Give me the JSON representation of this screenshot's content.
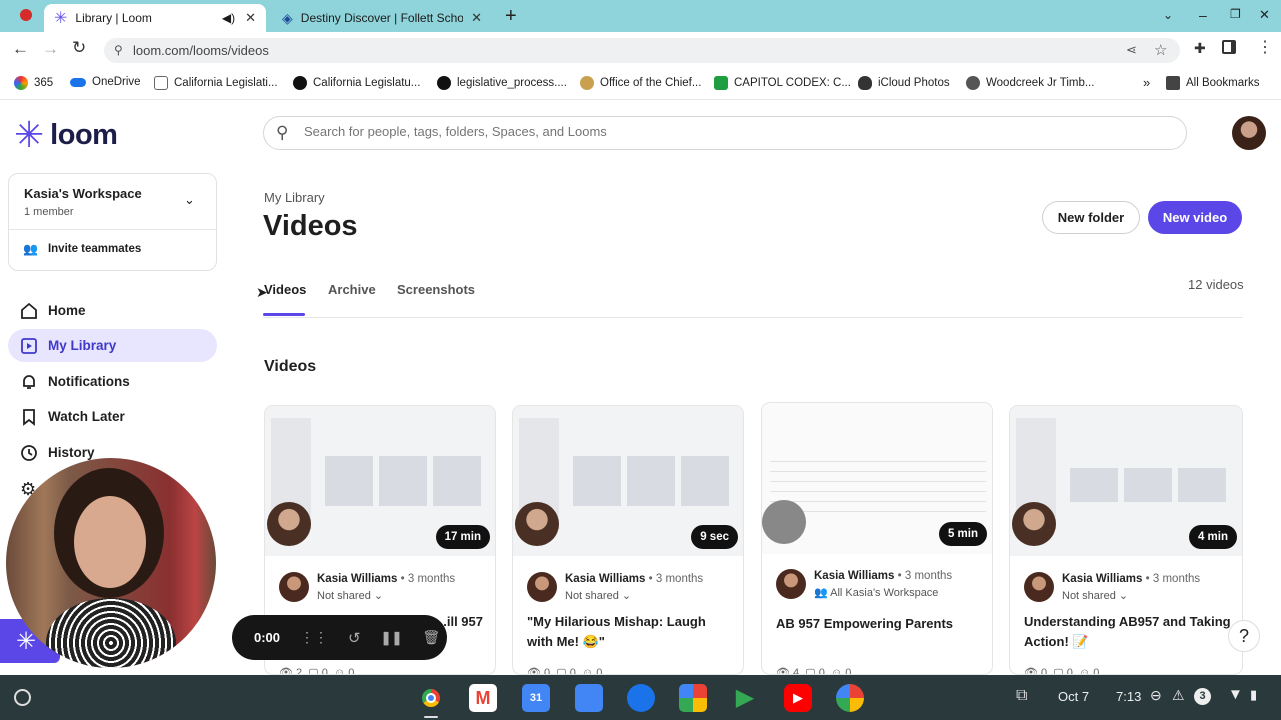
{
  "browser": {
    "tabs": [
      {
        "title": "Library | Loom",
        "active": true
      },
      {
        "title": "Destiny Discover | Follett School",
        "active": false
      }
    ],
    "url": "loom.com/looms/videos",
    "bookmarks": [
      "365",
      "OneDrive",
      "California Legislati...",
      "California Legislatu...",
      "legislative_process....",
      "Office of the Chief...",
      "CAPITOL CODEX: C...",
      "iCloud Photos",
      "Woodcreek Jr Timb..."
    ],
    "all_bookmarks": "All Bookmarks"
  },
  "sidebar": {
    "logo_text": "loom",
    "workspace_name": "Kasia's Workspace",
    "workspace_members": "1 member",
    "invite": "Invite teammates",
    "items": [
      {
        "label": "Home",
        "icon": "home-icon"
      },
      {
        "label": "My Library",
        "icon": "library-icon",
        "active": true
      },
      {
        "label": "Notifications",
        "icon": "bell-icon"
      },
      {
        "label": "Watch Later",
        "icon": "bookmark-icon"
      },
      {
        "label": "History",
        "icon": "clock-icon"
      }
    ]
  },
  "search": {
    "placeholder": "Search for people, tags, folders, Spaces, and Looms"
  },
  "main": {
    "breadcrumb": "My Library",
    "title": "Videos",
    "new_folder": "New folder",
    "new_video": "New video",
    "tabs": [
      "Videos",
      "Archive",
      "Screenshots"
    ],
    "count": "12 videos",
    "section_title": "Videos"
  },
  "videos": [
    {
      "duration": "17 min",
      "author": "Kasia Williams",
      "ago": "3 months",
      "share": "Not shared",
      "title": "...ill 957",
      "views": "2",
      "comments": "0",
      "reactions": "0"
    },
    {
      "duration": "9 sec",
      "author": "Kasia Williams",
      "ago": "3 months",
      "share": "Not shared",
      "title": "\"My Hilarious Mishap: Laugh with Me! 😂\"",
      "views": "0",
      "comments": "0",
      "reactions": "0"
    },
    {
      "duration": "5 min",
      "author": "Kasia Williams",
      "ago": "3 months",
      "share": "All Kasia's Workspace",
      "title": "AB 957 Empowering Parents",
      "views": "4",
      "comments": "0",
      "reactions": "0"
    },
    {
      "duration": "4 min",
      "author": "Kasia Williams",
      "ago": "3 months",
      "share": "Not shared",
      "title": "Understanding AB957 and Taking Action! 📝",
      "views": "0",
      "comments": "0",
      "reactions": "0"
    }
  ],
  "recorder": {
    "time": "0:00"
  },
  "help": "?",
  "taskbar": {
    "date": "Oct 7",
    "time": "7:13",
    "notifications": "3"
  },
  "colors": {
    "brand": "#5b47e8",
    "tabbar": "#8ed4da",
    "active_nav_bg": "#e8e6ff"
  }
}
